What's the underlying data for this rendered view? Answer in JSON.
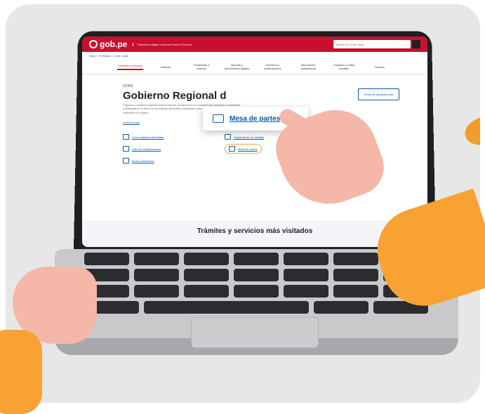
{
  "site": {
    "logo_text": "gob.pe",
    "tagline": "Plataforma digital única del Estado Peruano",
    "search_placeholder": "Buscar en Gore Cádiz",
    "breadcrumb": "Inicio > El Estado > Gore Cadiz"
  },
  "nav": {
    "items": [
      "Trámites y servicios",
      "Noticias",
      "Campañas y eventos",
      "Normas y documentos legales",
      "Informes y publicaciones",
      "Información institucional",
      "Contacto y redes sociales",
      "Turismo"
    ]
  },
  "hero": {
    "org_tag": "GORE",
    "title": "Gobierno Regional d",
    "description": "Organizar y conducir la gestión pública regional, de acuerdo a sus competencias exclusivas, compartidas y delegadas en el marco de las políticas nacionales y sectoriales, para contribuir al desarrollo integral y sostenible de la región.",
    "contact_link": "Conocer más",
    "portal_button": "Portal de transparencia"
  },
  "links": [
    {
      "label": "Convocatorias del Estado"
    },
    {
      "label": "Seguimiento de trámites"
    },
    {
      "label": "Libro de reclamaciones"
    },
    {
      "label": "Mesa de partes"
    },
    {
      "label": "Buzón electrónico"
    }
  ],
  "popup": {
    "label": "Mesa de partes"
  },
  "visited_title": "Trámites y servicios más visitados",
  "colors": {
    "brand_red": "#c8102e",
    "link_blue": "#0a58a8",
    "accent_orange": "#f7a233"
  }
}
